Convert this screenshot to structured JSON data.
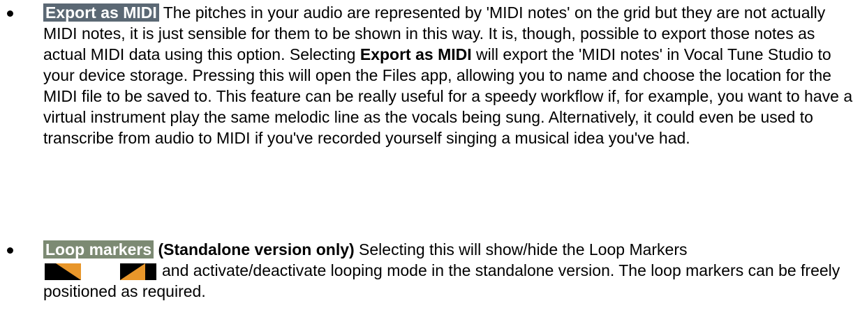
{
  "items": [
    {
      "tag": "Export as MIDI",
      "text_1": " The pitches in your audio are represented by 'MIDI notes' on the grid but they are not actually MIDI notes, it is just sensible for them to be shown in this way. It is, though, possible to export those notes as actual MIDI data using this option. Selecting ",
      "bold_1": "Export as MIDI",
      "text_2": " will export the 'MIDI notes' in Vocal Tune Studio to your device storage. Pressing this will open the Files app, allowing you to name and choose the location for the MIDI file to be saved to. This feature can be really useful for a speedy workflow if, for example, you want to have a virtual instrument play the same melodic line as the vocals being sung. Alternatively, it could even be used to transcribe from audio to MIDI if you've recorded yourself singing a musical idea you've had."
    },
    {
      "tag": "Loop markers",
      "bold_1": " (Standalone version only)",
      "text_1": " Selecting this will show/hide the Loop Markers",
      "text_2": "and activate/deactivate looping mode in the standalone version. The loop markers can be freely positioned as required."
    }
  ],
  "colors": {
    "export_tag_bg": "#5b6874",
    "loop_tag_bg": "#7c8a73",
    "marker_bar": "#000000",
    "marker_orange": "#e8962a"
  },
  "icons": {
    "loop_markers": "loop-markers-icon"
  }
}
